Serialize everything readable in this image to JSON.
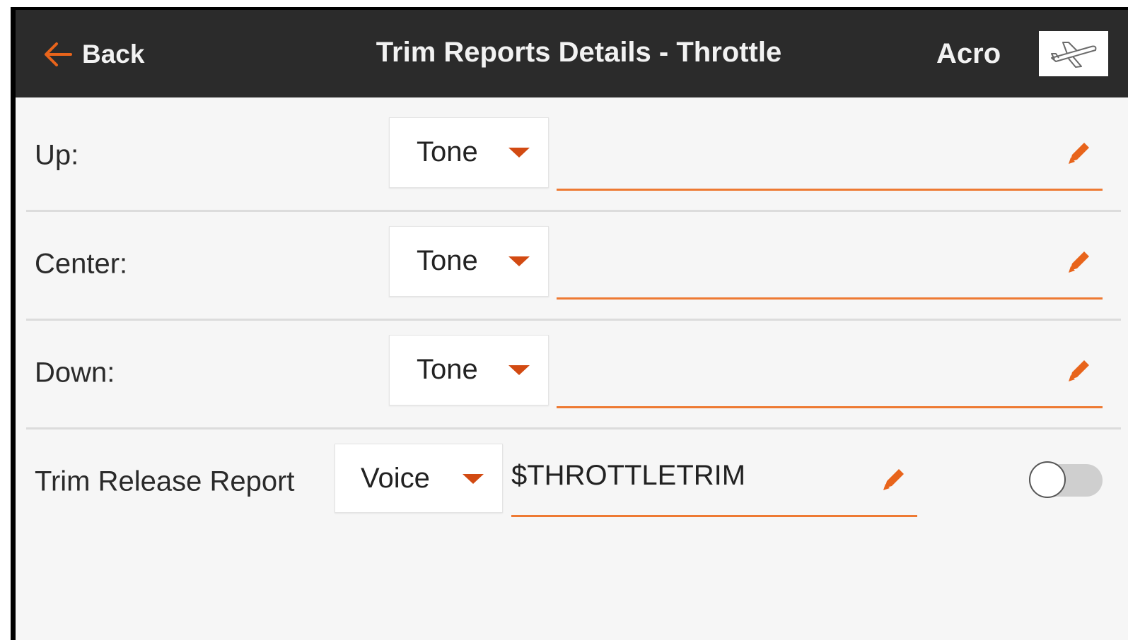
{
  "header": {
    "back_label": "Back",
    "title": "Trim Reports Details - Throttle",
    "model_name": "Acro",
    "model_icon": "airplane-icon"
  },
  "rows": [
    {
      "label": "Up:",
      "mode": "Tone",
      "value": ""
    },
    {
      "label": "Center:",
      "mode": "Tone",
      "value": ""
    },
    {
      "label": "Down:",
      "mode": "Tone",
      "value": ""
    }
  ],
  "trim_release": {
    "label": "Trim Release Report",
    "mode": "Voice",
    "value": "$THROTTLETRIM",
    "enabled": false
  },
  "colors": {
    "accent": "#e8641b",
    "caret": "#d24a12",
    "header_bg": "#2b2b2b",
    "screen_bg": "#f6f6f6"
  }
}
